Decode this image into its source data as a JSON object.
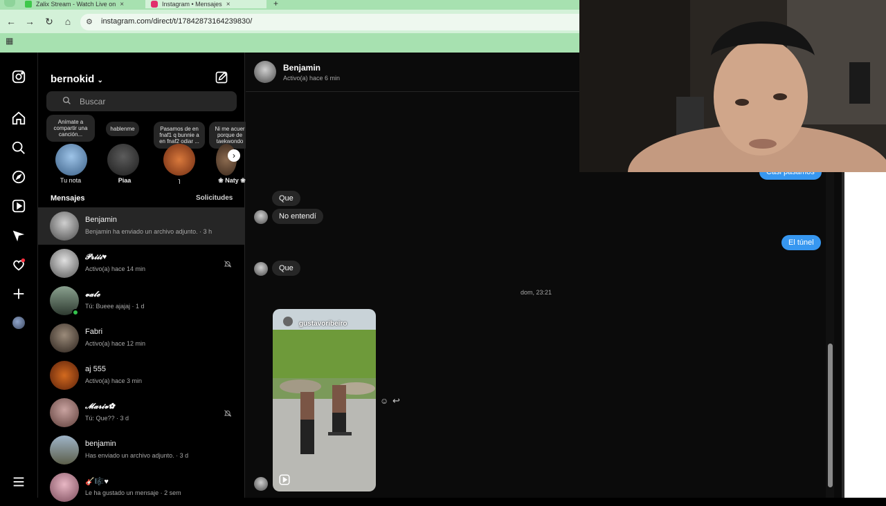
{
  "browser": {
    "tabs": [
      {
        "title": "Zalix Stream - Watch Live on",
        "icon_color": "#3ec84a"
      },
      {
        "title": "Instagram • Mensajes",
        "icon_color": "#e1306c"
      }
    ],
    "url": "instagram.com/direct/t/17842873164239830/",
    "new_tab": "+"
  },
  "sidebar_icons": [
    "instagram-logo-icon",
    "home-icon",
    "search-icon",
    "explore-icon",
    "reels-icon",
    "messages-icon",
    "notifications-icon",
    "create-icon",
    "profile-avatar",
    "menu-icon"
  ],
  "inbox": {
    "username": "bernokid",
    "search_placeholder": "Buscar",
    "notes": [
      {
        "note": "Anímate a compartir una canción...",
        "name": "Tu nota"
      },
      {
        "note": "hablenme",
        "name": "Piaa"
      },
      {
        "note": "Pasamos de en fnaf1 q bunnie a en fnaf2 odiar ...",
        "name": "ɿ"
      },
      {
        "note": "Ni me acuer porque de taekwondo",
        "name": "❀ Naty ❀"
      }
    ],
    "section_title": "Mensajes",
    "requests_label": "Solicitudes",
    "conversations": [
      {
        "name": "Benjamin",
        "sub": "Benjamin ha enviado un archivo adjunto. · 3 h",
        "muted": false,
        "online": false
      },
      {
        "name": "𝓟𝓻𝓲𝓲𝓲♥",
        "sub": "Activo(a) hace 14 min",
        "muted": true,
        "online": false
      },
      {
        "name": "𝓿𝓪𝓵𝓮",
        "sub": "Tú: Bueee ajajaj · 1 d",
        "muted": false,
        "online": true
      },
      {
        "name": "Fabri",
        "sub": "Activo(a) hace 12 min",
        "muted": false,
        "online": false
      },
      {
        "name": "aj 555",
        "sub": "Activo(a) hace 3 min",
        "muted": false,
        "online": false
      },
      {
        "name": "𝓜𝓪𝓻𝓲𝓿✿",
        "sub": "Tú: Que?? · 3 d",
        "muted": true,
        "online": false
      },
      {
        "name": "benjamin",
        "sub": "Has enviado un archivo adjunto. · 3 d",
        "muted": false,
        "online": false
      },
      {
        "name": "🎸🎼♥",
        "sub": "Le ha gustado un mensaje · 2 sem",
        "muted": false,
        "online": false
      }
    ]
  },
  "chat": {
    "name": "Benjamin",
    "status": "Activo(a) hace 6 min",
    "messages": {
      "out1": "Casi pasamos",
      "in1": "Que",
      "in2": "No entendí",
      "out2": "El túnel",
      "in3": "Que"
    },
    "timestamp": "dom, 23:21",
    "reel_user": "gustavoribeiro"
  },
  "colors": {
    "accent": "#3797f0",
    "online": "#33c24d",
    "chrome": "#a7e1b0"
  }
}
